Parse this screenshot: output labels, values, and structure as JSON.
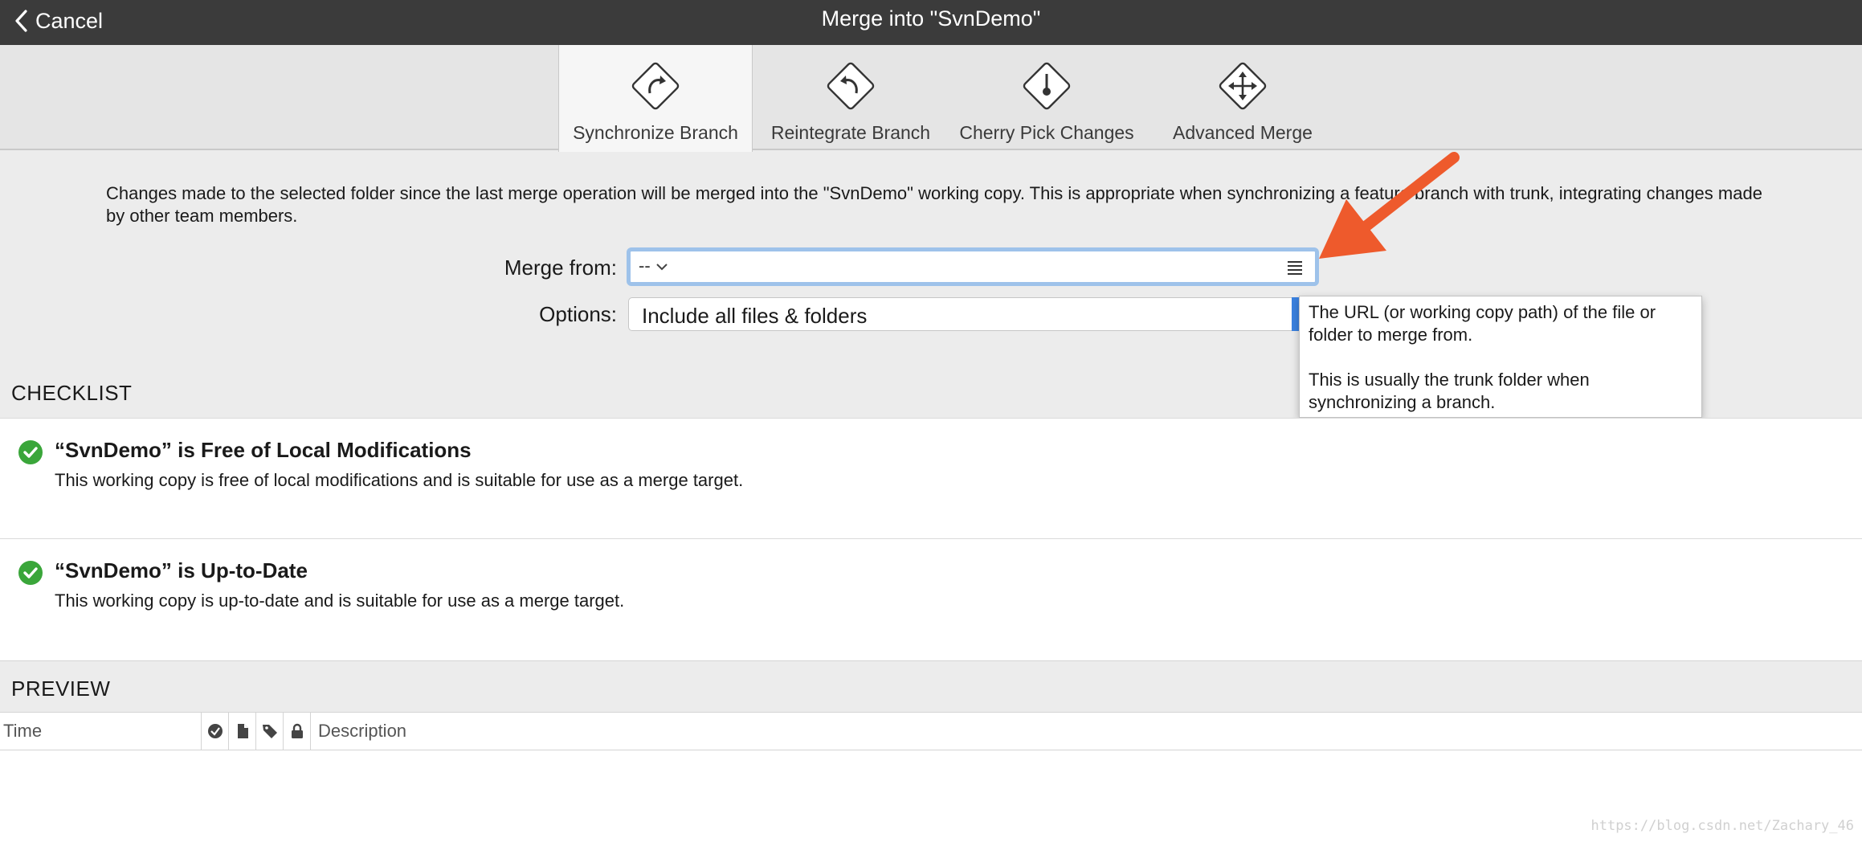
{
  "titlebar": {
    "cancel_label": "Cancel",
    "title": "Merge into \"SvnDemo\""
  },
  "toolbar": {
    "items": [
      {
        "label": "Synchronize Branch",
        "icon": "sync-branch-icon",
        "active": true
      },
      {
        "label": "Reintegrate Branch",
        "icon": "reintegrate-branch-icon",
        "active": false
      },
      {
        "label": "Cherry Pick Changes",
        "icon": "cherry-pick-icon",
        "active": false
      },
      {
        "label": "Advanced Merge",
        "icon": "advanced-merge-icon",
        "active": false
      }
    ]
  },
  "description": "Changes made to the selected folder since the last merge operation will be merged into the \"SvnDemo\" working copy. This is appropriate when synchronizing a feature branch with trunk, integrating changes made by other team members.",
  "form": {
    "merge_from_label": "Merge from:",
    "merge_from_value": "--",
    "options_label": "Options:",
    "options_value": "Include all files & folders"
  },
  "tooltip": {
    "line1": "The URL (or working copy path) of the file or folder to merge from.",
    "line2": "This is usually the trunk folder when synchronizing a branch."
  },
  "checklist": {
    "heading": "CHECKLIST",
    "items": [
      {
        "title": "“SvnDemo” is Free of Local Modifications",
        "subtitle": "This working copy is free of local modifications and is suitable for use as a merge target.",
        "status": "ok"
      },
      {
        "title": "“SvnDemo” is Up-to-Date",
        "subtitle": "This working copy is up-to-date and is suitable for use as a merge target.",
        "status": "ok"
      }
    ]
  },
  "preview": {
    "heading": "PREVIEW",
    "columns": {
      "time": "Time",
      "description": "Description"
    }
  },
  "watermark": "https://blog.csdn.net/Zachary_46",
  "colors": {
    "titlebar": "#3b3b3b",
    "accent": "#3b82e0",
    "focus_ring": "#9ec2ea",
    "arrow": "#ee5a2c",
    "ok_green": "#3aa63a"
  }
}
